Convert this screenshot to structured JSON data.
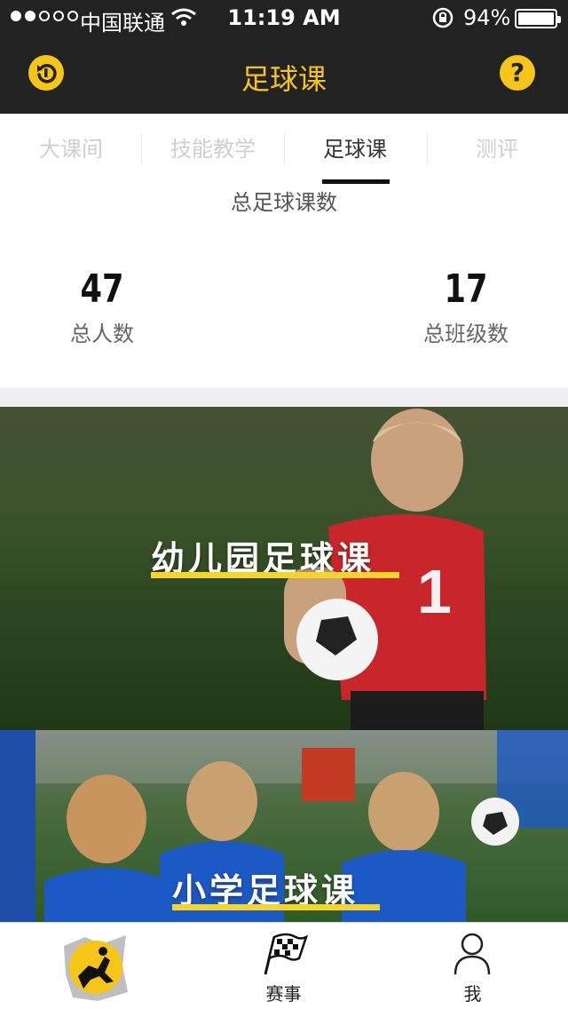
{
  "status_bar": {
    "carrier": "中国联通",
    "time": "11:19 AM",
    "battery": "94%"
  },
  "nav": {
    "title": "足球课",
    "back_icon": "refresh-back-icon",
    "help_icon": "help-icon",
    "help_glyph": "?"
  },
  "tabs": [
    {
      "label": "大课间",
      "active": false
    },
    {
      "label": "技能教学",
      "active": false
    },
    {
      "label": "足球课",
      "active": true
    },
    {
      "label": "测评",
      "active": false
    }
  ],
  "stats": {
    "title": "总足球课数",
    "total_people": {
      "value": "47",
      "label": "总人数"
    },
    "total_classes": {
      "value": "17",
      "label": "总班级数"
    }
  },
  "courses": [
    {
      "title": "幼儿园足球课"
    },
    {
      "title": "小学足球课"
    }
  ],
  "tab_bar": {
    "items": [
      {
        "label": "",
        "icon": "app-logo-icon"
      },
      {
        "label": "赛事",
        "icon": "checkered-flag-icon"
      },
      {
        "label": "我",
        "icon": "person-icon"
      }
    ]
  },
  "colors": {
    "accent": "#f5c518",
    "dark_bar": "#222222",
    "underline": "#f5d52a"
  }
}
